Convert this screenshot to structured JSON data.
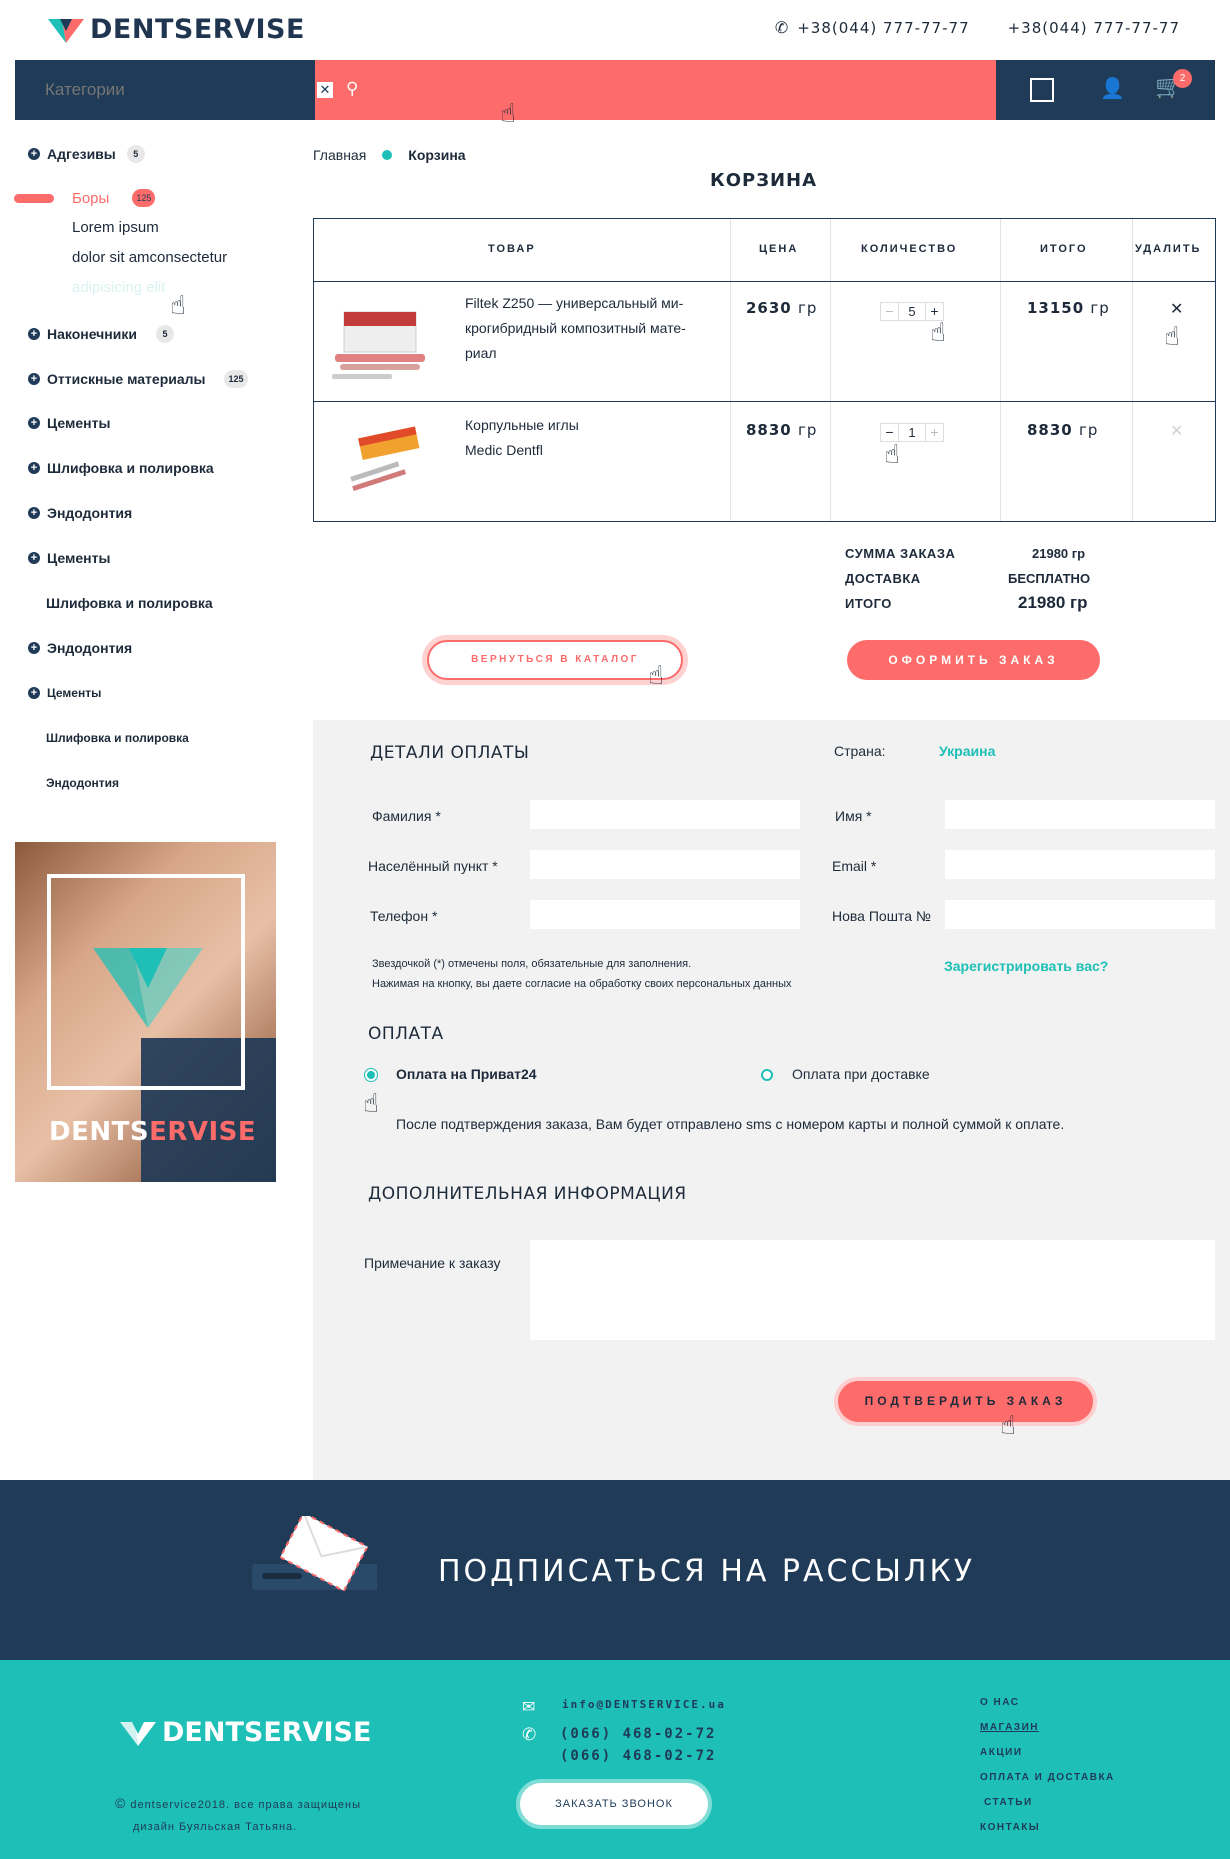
{
  "header": {
    "logo": "DENTSERVISE",
    "phone1": "+38(044) 777-77-77",
    "phone2": "+38(044) 777-77-77"
  },
  "topbar": {
    "category_placeholder": "Категории",
    "cart_count": "2"
  },
  "sidebar": {
    "items": [
      {
        "label": "Адгезивы",
        "count": "5"
      },
      {
        "label": "Боры",
        "count": "125"
      },
      {
        "label": "Наконечники",
        "count": "5"
      },
      {
        "label": "Оттискные материалы",
        "count": "125"
      },
      {
        "label": "Цементы"
      },
      {
        "label": "Шлифовка и полировка"
      },
      {
        "label": "Эндодонтия"
      },
      {
        "label": "Цементы"
      },
      {
        "label": "Шлифовка и полировка"
      },
      {
        "label": "Эндодонтия"
      },
      {
        "label": "Цементы"
      },
      {
        "label": "Шлифовка и полировка"
      },
      {
        "label": "Эндодонтия"
      }
    ],
    "sub_items": [
      "Lorem ipsum",
      "dolor sit amconsectetur",
      "adipisicing elit"
    ],
    "promo_brand_a": "DENTS",
    "promo_brand_b": "ERVISE"
  },
  "breadcrumb": {
    "home": "Главная",
    "current": "Корзина"
  },
  "page_title": "КОРЗИНА",
  "cart": {
    "headers": {
      "product": "ТОВАР",
      "price": "ЦЕНА",
      "qty": "КОЛИЧЕСТВО",
      "total": "ИТОГО",
      "delete": "УДАЛИТЬ"
    },
    "rows": [
      {
        "name_l1": "Filtek Z250 — универсальный ми-",
        "name_l2": "крогибридный композитный мате-",
        "name_l3": "риал",
        "price": "2630",
        "qty": "5",
        "total": "13150",
        "unit": "гр"
      },
      {
        "name_l1": "Корпульные иглы",
        "name_l2": "Medic Dentfl",
        "price": "8830",
        "qty": "1",
        "total": "8830",
        "unit": "гр"
      }
    ]
  },
  "summary": {
    "sum_label": "СУММА ЗАКАЗА",
    "sum_value": "21980 гр",
    "delivery_label": "ДОСТАВКА",
    "delivery_value": "БЕСПЛАТНО",
    "total_label": "ИТОГО",
    "total_value": "21980 гр"
  },
  "buttons": {
    "back": "ВЕРНУТЬСЯ В КАТАЛОГ",
    "checkout": "ОФОРМИТЬ ЗАКАЗ",
    "confirm": "ПОДТВЕРДИТЬ ЗАКАЗ"
  },
  "payment": {
    "title": "ДЕТАЛИ ОПЛАТЫ",
    "country_label": "Страна:",
    "country_value": "Украина",
    "fields": {
      "surname": "Фамилия *",
      "name": "Имя *",
      "city": "Населённый пункт *",
      "email": "Email *",
      "phone": "Телефон *",
      "np": "Нова Пошта №"
    },
    "note1": "Звездочкой (*) отмечены поля, обязательные для заполнения.",
    "note2": "Нажимая на кнопку, вы даете согласие на обработку своих персональных данных",
    "register": "Зарегистрировать вас?",
    "pay_title": "ОПЛАТА",
    "option1": "Оплата на Приват24",
    "option2": "Оплата при доставке",
    "pay_info": "После подтверждения заказа, Вам будет отправлено sms с номером карты и полной суммой к оплате.",
    "extra_title": "ДОПОЛНИТЕЛЬНАЯ ИНФОРМАЦИЯ",
    "order_note": "Примечание к заказу"
  },
  "newsletter": {
    "title": "ПОДПИСАТЬСЯ НА РАССЫЛКУ"
  },
  "footer": {
    "logo": "DENTSERVISE",
    "copy1": "dentservice2018. все права защищены",
    "copy2": "дизайн Буяльская Татьяна.",
    "email": "info@DENTSERVICE.ua",
    "phone1": "(066) 468-02-72",
    "phone2": "(066) 468-02-72",
    "call_btn": "ЗАКАЗАТЬ ЗВОНОК",
    "menu": [
      "О НАС",
      "МАГАЗИН",
      "АКЦИИ",
      "ОПЛАТА И ДОСТАВКА",
      "СТАТЬИ",
      "КОНТАКЫ"
    ]
  },
  "colors": {
    "navy": "#1f3b57",
    "coral": "#fd6b6a",
    "teal": "#1dbfb6"
  },
  "icons": [
    "logo-tooth-icon",
    "phone-icon",
    "search-icon",
    "clear-icon",
    "square-icon",
    "user-icon",
    "cart-icon",
    "plus-circle-icon",
    "close-icon",
    "envelope-icon",
    "hand-cursor-icon"
  ]
}
